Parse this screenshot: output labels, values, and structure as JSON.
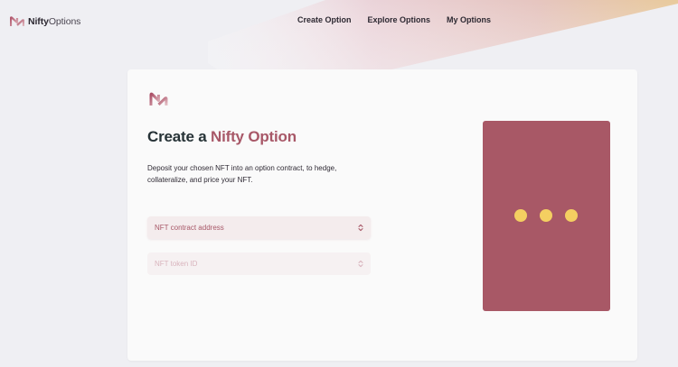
{
  "brand": {
    "name_bold": "Nifty",
    "name_light": "Options",
    "logo_icon": "nifty-logo-icon"
  },
  "nav": {
    "items": [
      {
        "label": "Create Option"
      },
      {
        "label": "Explore Options"
      },
      {
        "label": "My Options"
      }
    ]
  },
  "main": {
    "title_plain": "Create a ",
    "title_accent": "Nifty Option",
    "description": "Deposit your chosen NFT into an option contract, to hedge, collateralize, and price your NFT.",
    "fields": [
      {
        "label": "NFT contract address",
        "icon": "chevron-up-down-icon",
        "state": "active"
      },
      {
        "label": "NFT token ID",
        "icon": "chevron-up-down-icon",
        "state": "disabled"
      }
    ],
    "preview": {
      "state": "loading",
      "dot_count": 3
    }
  },
  "colors": {
    "accent": "#a85868",
    "preview_background": "#a85866",
    "loading_dots": "#f4cf61",
    "title_dark": "#263236"
  }
}
